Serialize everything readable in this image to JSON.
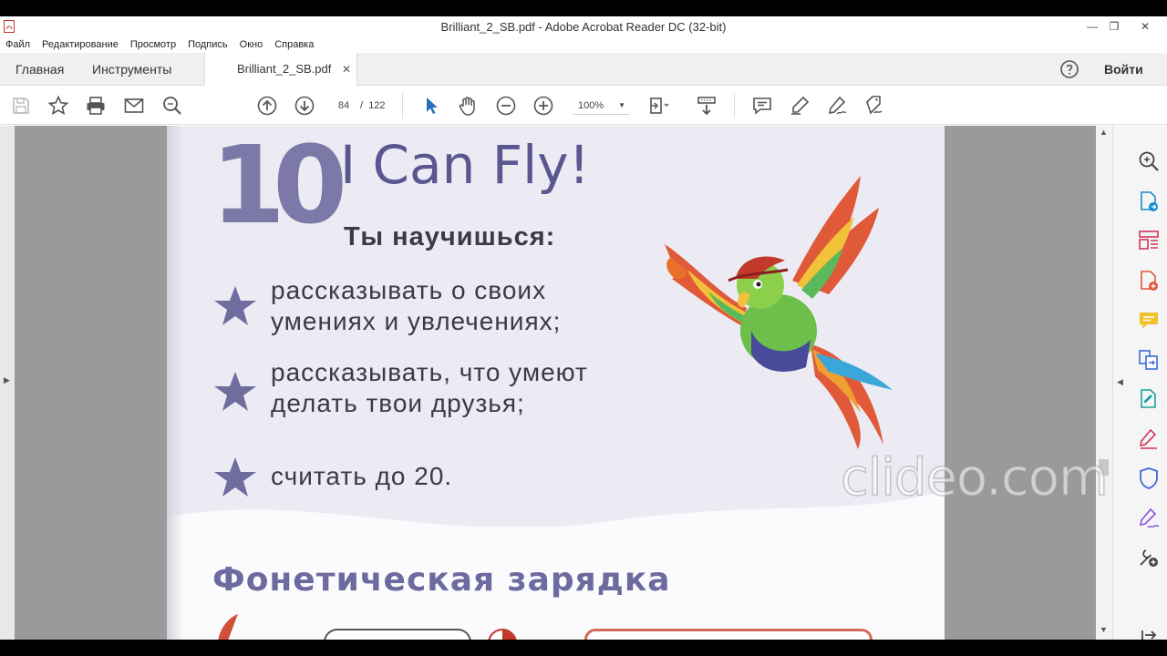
{
  "window": {
    "title": "Brilliant_2_SB.pdf - Adobe Acrobat Reader DC (32-bit)",
    "minimize": "—",
    "restore": "❐",
    "close": "✕"
  },
  "menu": [
    "Файл",
    "Редактирование",
    "Просмотр",
    "Подпись",
    "Окно",
    "Справка"
  ],
  "tabs": {
    "home": "Главная",
    "tools": "Инструменты",
    "document": "Brilliant_2_SB.pdf",
    "close": "✕",
    "signin": "Войти"
  },
  "toolbar": {
    "page_current": "84",
    "page_separator": "/",
    "page_total": "122",
    "zoom": "100%"
  },
  "page": {
    "unit_number": "10",
    "unit_title": "I Can Fly!",
    "subtitle": "Ты научишься:",
    "bullets": [
      {
        "line1": "рассказывать о своих",
        "line2": "умениях и увлечениях;"
      },
      {
        "line1": "рассказывать, что умеют",
        "line2": "делать твои друзья;"
      },
      {
        "line1": "считать до 20.",
        "line2": ""
      }
    ],
    "section_title": "Фонетическая зарядка"
  },
  "watermark": "clideo.com",
  "colors": {
    "accent_blue": "#2d6fb7",
    "unit_purple": "#7c79a8",
    "title_purple": "#5a5790",
    "star_purple": "#6f6c9e"
  },
  "icons": {
    "toolbar": [
      "save-icon",
      "bookmark-star-icon",
      "print-icon",
      "email-icon",
      "search-icon",
      "page-up-icon",
      "page-down-icon",
      "select-arrow-icon",
      "hand-icon",
      "zoom-out-icon",
      "zoom-in-icon",
      "page-fit-icon",
      "scroll-mode-icon",
      "comment-icon",
      "highlight-pen-icon",
      "sign-icon",
      "fill-sign-icon"
    ],
    "right_panel": [
      "search-zoom-icon",
      "export-pdf-icon",
      "organize-pages-icon",
      "create-pdf-icon",
      "comment-icon",
      "combine-files-icon",
      "edit-pdf-icon",
      "fill-sign-icon",
      "protect-icon",
      "send-sign-icon",
      "more-tools-icon",
      "collapse-panel-icon"
    ]
  }
}
